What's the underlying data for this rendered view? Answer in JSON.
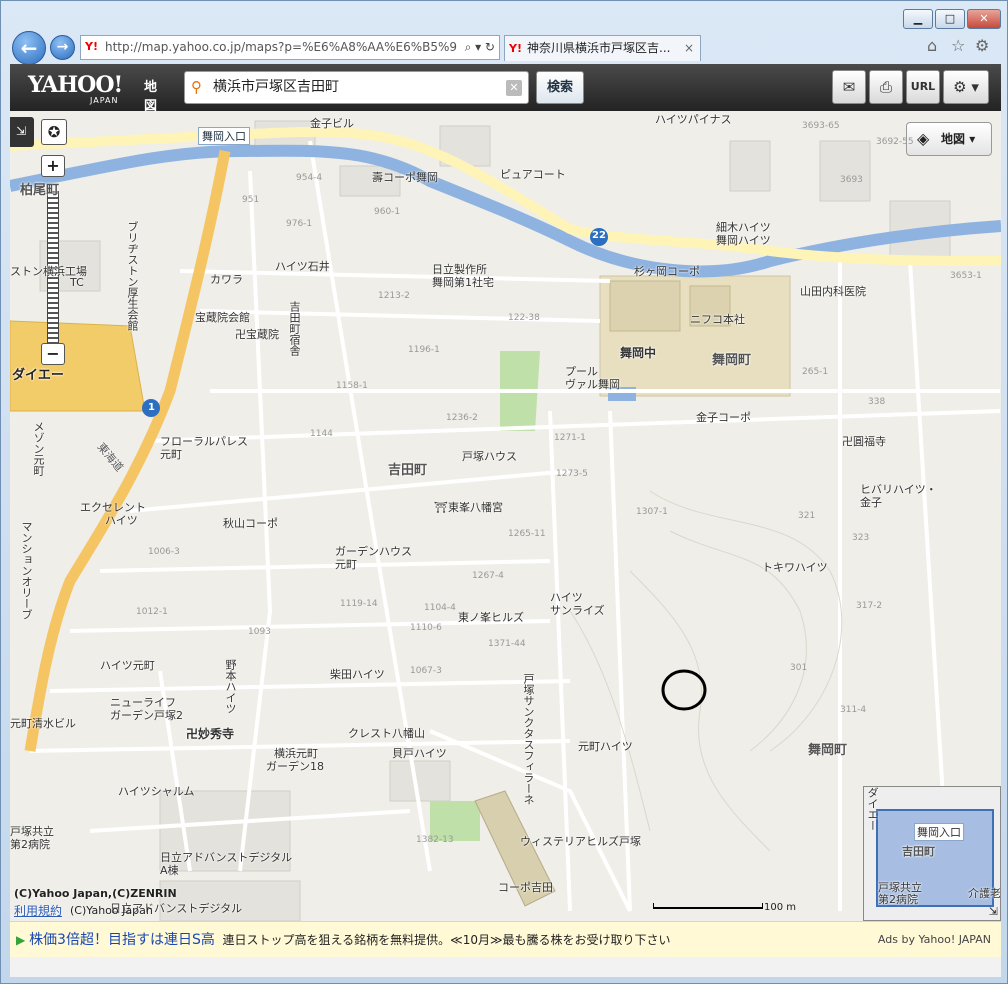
{
  "browser": {
    "url": "http://map.yahoo.co.jp/maps?p=%E6%A8%AA%E6%B5%9",
    "tab_title": "神奈川県横浜市戸塚区吉...",
    "minimize": "▁",
    "maximize": "□",
    "close": "✕",
    "back_glyph": "←",
    "forward_glyph": "→",
    "url_tools": "⌕ ▾ ↻",
    "tab_close": "×",
    "home_icon": "home-icon",
    "favorites_icon": "star-icon",
    "tools_icon": "gear-icon"
  },
  "toolbar": {
    "logo": "YAHOO!",
    "logo_sub": "JAPAN",
    "logo_service": "地図",
    "search_value": "横浜市戸塚区吉田町",
    "search_button": "検索",
    "mail_icon": "mail-icon",
    "print_icon": "print-icon",
    "url_button": "URL",
    "settings_icon": "gear-icon"
  },
  "map": {
    "layer_button": "地図",
    "zoom_in": "+",
    "zoom_out": "−",
    "labels": {
      "maioka_iriguchi": "舞岡入口",
      "kanekobiru": "金子ビル",
      "kashiohara": "柏尾町",
      "kotobuki_corpo": "壽コーポ舞岡",
      "pure_court": "ピュアコート",
      "haitsu_pines": "ハイツパイナス",
      "hosogi": "細木ハイツ",
      "maioka_haitsu": "舞岡ハイツ",
      "hitachi": "日立製作所",
      "hitachi2": "舞岡第1社宅",
      "sugigaoka": "杉ヶ岡コーポ",
      "yamada": "山田内科医院",
      "nifuko": "ニフコ本社",
      "maioka_chu": "舞岡中",
      "maioka_cho": "舞岡町",
      "kawara": "カワラ",
      "haitsu_ishii": "ハイツ石井",
      "hozoin_kaikan": "宝蔵院会館",
      "hozoin": "卍宝蔵院",
      "yoshidacho_shukusha": "吉田町宿舎",
      "daiei": "ダイエー",
      "pool": "プール",
      "vial": "ヴァル舞岡",
      "kaneko_corpo": "金子コーポ",
      "enpukuji": "卍圓福寺",
      "floral": "フローラルパレス",
      "floral2": "元町",
      "totsuka_house": "戸塚ハウス",
      "yoshidacho": "吉田町",
      "higashimine": "⛩東峯八幡宮",
      "hibari": "ヒバリハイツ・",
      "hibari2": "金子",
      "excellent": "エクセレント",
      "excellent2": "ハイツ",
      "akiyama": "秋山コーポ",
      "garden_house": "ガーデンハウス",
      "garden_house2": "元町",
      "tokiwa": "トキワハイツ",
      "haitsu_sunrise": "ハイツ",
      "haitsu_sunrise2": "サンライズ",
      "higashinomine": "東ノ峯ヒルズ",
      "haitsu_motomachi": "ハイツ元町",
      "shibata": "柴田ハイツ",
      "nomoto": "野本ハイツ",
      "newlife": "ニューライフ",
      "newlife2": "ガーデン戸塚2",
      "myoshuji": "卍妙秀寺",
      "crest": "クレスト八幡山",
      "kaido": "貝戸ハイツ",
      "sanctus": "戸塚サンクタスフィラーネ",
      "motomachi_haitsu": "元町ハイツ",
      "motomachi_shimizu": "元町清水ビル",
      "yokohama_motomachi": "横浜元町",
      "yokohama_motomachi2": "ガーデン18",
      "haitsu_shalom": "ハイツシャルム",
      "wisteria": "ウィステリアヒルズ戸塚",
      "totsuka_kyoritsu": "戸塚共立",
      "totsuka_kyoritsu2": "第2病院",
      "hitachi_adv": "日立アドバンストデジタル",
      "hitachi_adv2": "A棟",
      "hitachi_adv3": "日立アドバンストデジタル",
      "corpo_yoshida": "コーポ吉田",
      "tokaido": "東海道",
      "bridgestone": "ブリヂストン厚生会館",
      "ston_factory": "ストン横浜工場",
      "ston_factory2": "TC",
      "mezon": "メゾン元町",
      "mansion": "マンションオリーブ",
      "nurse": "介護老",
      "route22": "22",
      "route1": "1"
    },
    "numbers": {
      "n1": "951",
      "n2": "960-1",
      "n3": "976-1",
      "n4": "954-4",
      "n5": "1213-2",
      "n6": "1196-1",
      "n7": "1158-1",
      "n8": "1144",
      "n9": "1236-2",
      "n10": "1271-1",
      "n11": "1273-5",
      "n12": "1265-11",
      "n13": "1307-1",
      "n14": "1267-4",
      "n15": "1104-4",
      "n16": "1119-14",
      "n17": "1006-3",
      "n18": "1012-1",
      "n19": "1093",
      "n20": "1110-6",
      "n21": "1371-44",
      "n22": "1067-3",
      "n23": "3693-65",
      "n24": "3692-55",
      "n25": "265-1",
      "n26": "338",
      "n27": "321",
      "n28": "323",
      "n29": "317-2",
      "n30": "301",
      "n31": "311-4",
      "n32": "122-38",
      "n33": "1382-13",
      "n34": "3693",
      "n35": "3653-1"
    },
    "copyright": "(C)Yahoo Japan,(C)ZENRIN",
    "terms_link": "利用規約",
    "terms_copy": "(C)Yahoo Japan",
    "scale": "100 m",
    "mini_label1": "舞岡入口",
    "mini_label2": "吉田町",
    "mini_label3": "戸塚共立",
    "mini_label4": "第2病院",
    "mini_label5": "介護老",
    "mini_label6": "ダイエー"
  },
  "ad": {
    "play": "▶",
    "headline": "株価3倍超！目指すは連日S高",
    "text": "連日ストップ高を狙える銘柄を無料提供。≪10月≫最も騰る株をお受け取り下さい",
    "by": "Ads by Yahoo! JAPAN"
  },
  "colors": {
    "accent": "#2c6ec0",
    "river": "#8fb3e0",
    "road": "#fff4b8",
    "arterial": "#f5c564",
    "school": "#e8dfc0",
    "daiei": "#f3cc6a"
  }
}
